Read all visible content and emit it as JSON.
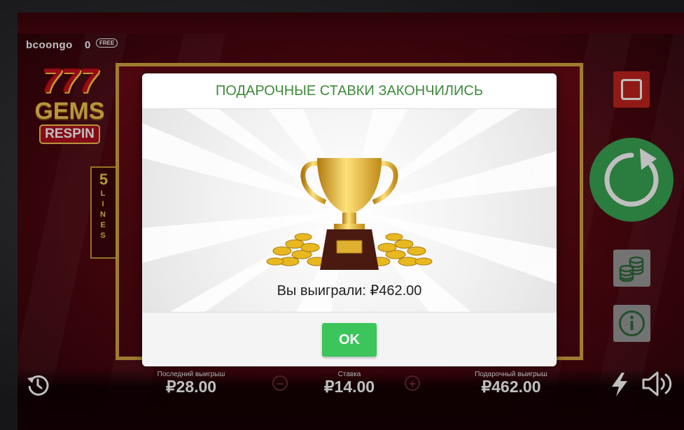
{
  "header": {
    "brand": "bcoongo",
    "free_count": "0",
    "free_badge": "FREE"
  },
  "logo": {
    "sevens": "777",
    "gems": "GEMS",
    "respin": "RESPIN"
  },
  "lines_panel": {
    "number": "5",
    "word": [
      "L",
      "I",
      "N",
      "E",
      "S"
    ]
  },
  "modal": {
    "title": "ПОДАРОЧНЫЕ СТАВКИ ЗАКОНЧИЛИСЬ",
    "win_text": "Вы выиграли: ₽462.00",
    "ok_label": "OK"
  },
  "stats": {
    "last_win_label": "Последний выигрыш",
    "last_win_value": "₽28.00",
    "bet_label": "Ставка",
    "bet_value": "₽14.00",
    "gift_win_label": "Подарочный выигрыш",
    "gift_win_value": "₽462.00"
  },
  "controls": {
    "minus": "−",
    "plus": "+",
    "icons": [
      "history-icon",
      "stop-icon",
      "spin-icon",
      "coins-icon",
      "info-icon",
      "lightning-icon",
      "speaker-icon"
    ]
  },
  "colors": {
    "modal_title": "#3f8a3a",
    "ok_button": "#3cc55a",
    "spin_button": "#3aa655",
    "stop_button": "#c0241e",
    "frame_gold": "#d4a640"
  }
}
